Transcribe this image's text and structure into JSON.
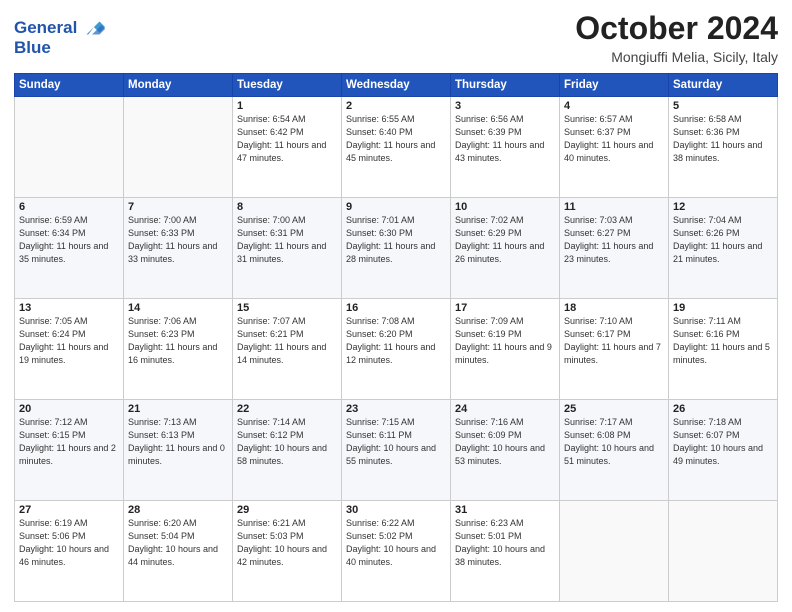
{
  "header": {
    "logo_line1": "General",
    "logo_line2": "Blue",
    "month_title": "October 2024",
    "location": "Mongiuffi Melia, Sicily, Italy"
  },
  "columns": [
    "Sunday",
    "Monday",
    "Tuesday",
    "Wednesday",
    "Thursday",
    "Friday",
    "Saturday"
  ],
  "weeks": [
    [
      {
        "day": "",
        "info": ""
      },
      {
        "day": "",
        "info": ""
      },
      {
        "day": "1",
        "info": "Sunrise: 6:54 AM\nSunset: 6:42 PM\nDaylight: 11 hours and 47 minutes."
      },
      {
        "day": "2",
        "info": "Sunrise: 6:55 AM\nSunset: 6:40 PM\nDaylight: 11 hours and 45 minutes."
      },
      {
        "day": "3",
        "info": "Sunrise: 6:56 AM\nSunset: 6:39 PM\nDaylight: 11 hours and 43 minutes."
      },
      {
        "day": "4",
        "info": "Sunrise: 6:57 AM\nSunset: 6:37 PM\nDaylight: 11 hours and 40 minutes."
      },
      {
        "day": "5",
        "info": "Sunrise: 6:58 AM\nSunset: 6:36 PM\nDaylight: 11 hours and 38 minutes."
      }
    ],
    [
      {
        "day": "6",
        "info": "Sunrise: 6:59 AM\nSunset: 6:34 PM\nDaylight: 11 hours and 35 minutes."
      },
      {
        "day": "7",
        "info": "Sunrise: 7:00 AM\nSunset: 6:33 PM\nDaylight: 11 hours and 33 minutes."
      },
      {
        "day": "8",
        "info": "Sunrise: 7:00 AM\nSunset: 6:31 PM\nDaylight: 11 hours and 31 minutes."
      },
      {
        "day": "9",
        "info": "Sunrise: 7:01 AM\nSunset: 6:30 PM\nDaylight: 11 hours and 28 minutes."
      },
      {
        "day": "10",
        "info": "Sunrise: 7:02 AM\nSunset: 6:29 PM\nDaylight: 11 hours and 26 minutes."
      },
      {
        "day": "11",
        "info": "Sunrise: 7:03 AM\nSunset: 6:27 PM\nDaylight: 11 hours and 23 minutes."
      },
      {
        "day": "12",
        "info": "Sunrise: 7:04 AM\nSunset: 6:26 PM\nDaylight: 11 hours and 21 minutes."
      }
    ],
    [
      {
        "day": "13",
        "info": "Sunrise: 7:05 AM\nSunset: 6:24 PM\nDaylight: 11 hours and 19 minutes."
      },
      {
        "day": "14",
        "info": "Sunrise: 7:06 AM\nSunset: 6:23 PM\nDaylight: 11 hours and 16 minutes."
      },
      {
        "day": "15",
        "info": "Sunrise: 7:07 AM\nSunset: 6:21 PM\nDaylight: 11 hours and 14 minutes."
      },
      {
        "day": "16",
        "info": "Sunrise: 7:08 AM\nSunset: 6:20 PM\nDaylight: 11 hours and 12 minutes."
      },
      {
        "day": "17",
        "info": "Sunrise: 7:09 AM\nSunset: 6:19 PM\nDaylight: 11 hours and 9 minutes."
      },
      {
        "day": "18",
        "info": "Sunrise: 7:10 AM\nSunset: 6:17 PM\nDaylight: 11 hours and 7 minutes."
      },
      {
        "day": "19",
        "info": "Sunrise: 7:11 AM\nSunset: 6:16 PM\nDaylight: 11 hours and 5 minutes."
      }
    ],
    [
      {
        "day": "20",
        "info": "Sunrise: 7:12 AM\nSunset: 6:15 PM\nDaylight: 11 hours and 2 minutes."
      },
      {
        "day": "21",
        "info": "Sunrise: 7:13 AM\nSunset: 6:13 PM\nDaylight: 11 hours and 0 minutes."
      },
      {
        "day": "22",
        "info": "Sunrise: 7:14 AM\nSunset: 6:12 PM\nDaylight: 10 hours and 58 minutes."
      },
      {
        "day": "23",
        "info": "Sunrise: 7:15 AM\nSunset: 6:11 PM\nDaylight: 10 hours and 55 minutes."
      },
      {
        "day": "24",
        "info": "Sunrise: 7:16 AM\nSunset: 6:09 PM\nDaylight: 10 hours and 53 minutes."
      },
      {
        "day": "25",
        "info": "Sunrise: 7:17 AM\nSunset: 6:08 PM\nDaylight: 10 hours and 51 minutes."
      },
      {
        "day": "26",
        "info": "Sunrise: 7:18 AM\nSunset: 6:07 PM\nDaylight: 10 hours and 49 minutes."
      }
    ],
    [
      {
        "day": "27",
        "info": "Sunrise: 6:19 AM\nSunset: 5:06 PM\nDaylight: 10 hours and 46 minutes."
      },
      {
        "day": "28",
        "info": "Sunrise: 6:20 AM\nSunset: 5:04 PM\nDaylight: 10 hours and 44 minutes."
      },
      {
        "day": "29",
        "info": "Sunrise: 6:21 AM\nSunset: 5:03 PM\nDaylight: 10 hours and 42 minutes."
      },
      {
        "day": "30",
        "info": "Sunrise: 6:22 AM\nSunset: 5:02 PM\nDaylight: 10 hours and 40 minutes."
      },
      {
        "day": "31",
        "info": "Sunrise: 6:23 AM\nSunset: 5:01 PM\nDaylight: 10 hours and 38 minutes."
      },
      {
        "day": "",
        "info": ""
      },
      {
        "day": "",
        "info": ""
      }
    ]
  ]
}
